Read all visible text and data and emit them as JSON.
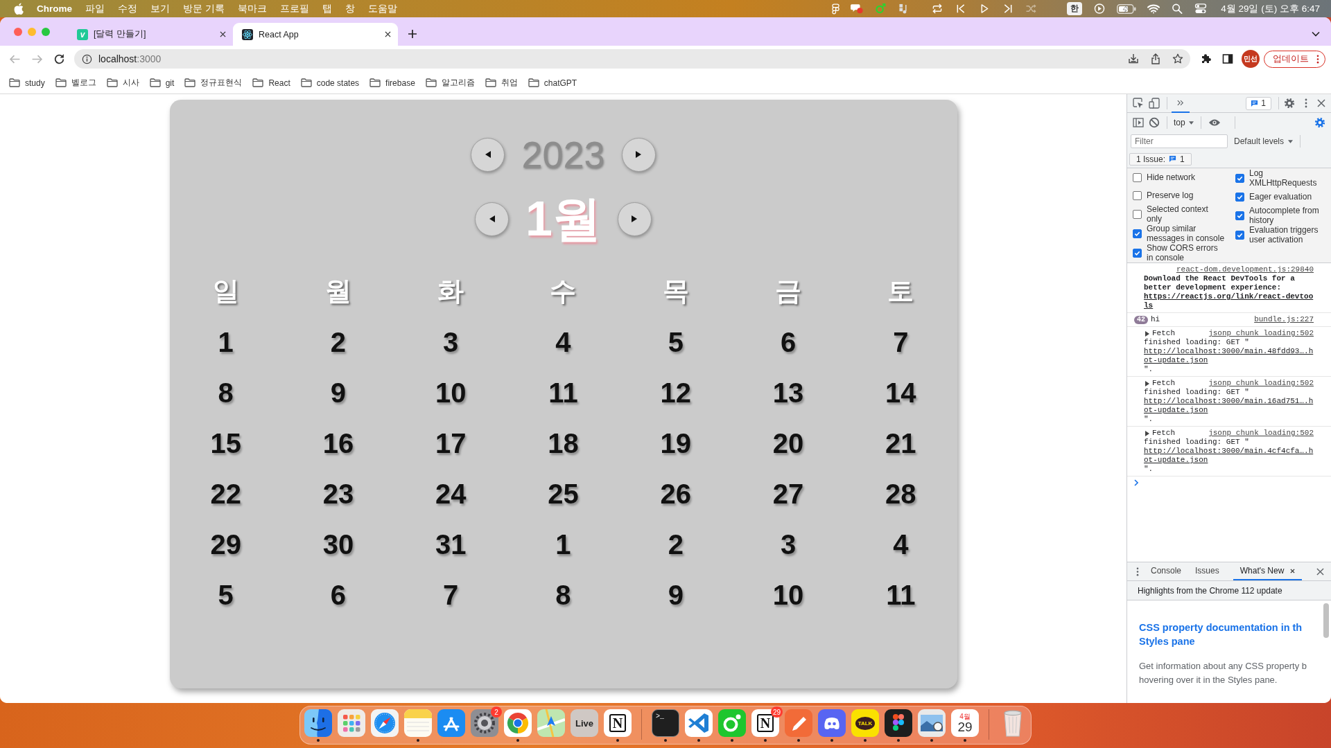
{
  "menu_bar": {
    "app": "Chrome",
    "menus": [
      "파일",
      "수정",
      "보기",
      "방문 기록",
      "북마크",
      "프로필",
      "탭",
      "창",
      "도움말"
    ],
    "input_source": "한",
    "clock": "4월 29일 (토) 오후 6:47"
  },
  "tabs": [
    {
      "kind": "letter",
      "favicon_text": "v",
      "title": "[달력 만들기]",
      "selected": false
    },
    {
      "kind": "react",
      "title": "React App",
      "selected": true
    }
  ],
  "toolbar": {
    "back_disabled": true,
    "forward_disabled": true,
    "url_host": "localhost",
    "url_port": ":3000",
    "profile": "민선",
    "update_button": "업데이트"
  },
  "bookmarks": [
    "study",
    "벨로그",
    "시사",
    "git",
    "정규표현식",
    "React",
    "code states",
    "firebase",
    "알고리즘",
    "취업",
    "chatGPT"
  ],
  "calendar": {
    "year": "2023",
    "month": "1월",
    "weekdays": [
      "일",
      "월",
      "화",
      "수",
      "목",
      "금",
      "토"
    ],
    "weeks": [
      [
        "1",
        "2",
        "3",
        "4",
        "5",
        "6",
        "7"
      ],
      [
        "8",
        "9",
        "10",
        "11",
        "12",
        "13",
        "14"
      ],
      [
        "15",
        "16",
        "17",
        "18",
        "19",
        "20",
        "21"
      ],
      [
        "22",
        "23",
        "24",
        "25",
        "26",
        "27",
        "28"
      ],
      [
        "29",
        "30",
        "31",
        "1",
        "2",
        "3",
        "4"
      ],
      [
        "5",
        "6",
        "7",
        "8",
        "9",
        "10",
        "11"
      ]
    ]
  },
  "devtools": {
    "more_tabs_selected": true,
    "issues_badge": "1",
    "context": "top",
    "settings_open": true,
    "filter_placeholder": "Filter",
    "levels": "Default levels",
    "issues_label": "1 Issue:",
    "issues_count": "1",
    "settings_left": [
      {
        "label": "Hide network",
        "checked": false
      },
      {
        "label": "Preserve log",
        "checked": false
      },
      {
        "label": "Selected context only",
        "checked": false
      },
      {
        "label": "Group similar messages in console",
        "checked": true
      },
      {
        "label": "Show CORS errors in console",
        "checked": true
      }
    ],
    "settings_right": [
      {
        "label": "Log XMLHttpRequests",
        "checked": true
      },
      {
        "label": "Eager evaluation",
        "checked": true
      },
      {
        "label": "Autocomplete from history",
        "checked": true
      },
      {
        "label": "Evaluation triggers user activation",
        "checked": true
      }
    ],
    "messages": [
      {
        "kind": "info",
        "source": "react-dom.development.js:29840",
        "text": "Download the React DevTools for a better development experience:",
        "link": "https://reactjs.org/link/react-devtools"
      },
      {
        "kind": "repeat",
        "count": "42",
        "text": "hi",
        "source": "bundle.js:227"
      },
      {
        "kind": "fetch",
        "label": "Fetch",
        "expanded": false,
        "source": "jsonp chunk loading:502",
        "text": "finished loading: GET \"",
        "link": "http://localhost:3000/main.48fdd93….hot-update.json",
        "after": "\"."
      },
      {
        "kind": "fetch",
        "label": "Fetch",
        "expanded": false,
        "source": "jsonp chunk loading:502",
        "text": "finished loading: GET \"",
        "link": "http://localhost:3000/main.16ad751….hot-update.json",
        "after": "\"."
      },
      {
        "kind": "fetch",
        "label": "Fetch",
        "expanded": false,
        "source": "jsonp chunk loading:502",
        "text": "finished loading: GET \"",
        "link": "http://localhost:3000/main.4cf4cfa….hot-update.json",
        "after": "\"."
      }
    ],
    "drawer": {
      "tabs": [
        {
          "label": "Console",
          "selected": false,
          "closable": false
        },
        {
          "label": "Issues",
          "selected": false,
          "closable": false
        },
        {
          "label": "What's New",
          "selected": true,
          "closable": true
        }
      ],
      "banner": "Highlights from the Chrome 112 update",
      "heading_lines": [
        "CSS property documentation in th",
        "Styles pane"
      ],
      "body_lines": [
        "Get information about any CSS property b",
        "hovering over it in the Styles pane."
      ]
    }
  },
  "dock": {
    "sections": [
      {
        "items": [
          {
            "kind": "finder",
            "running": true
          },
          {
            "kind": "launchpad",
            "running": false
          },
          {
            "kind": "safari",
            "running": false
          },
          {
            "kind": "notes",
            "running": true
          },
          {
            "kind": "appstore",
            "running": false
          },
          {
            "kind": "settings",
            "badge": "2",
            "running": false
          },
          {
            "kind": "chrome",
            "running": true
          },
          {
            "kind": "maps",
            "running": false
          },
          {
            "kind": "live",
            "label": "Live",
            "running": false
          },
          {
            "kind": "notion",
            "label": "N",
            "running": true
          }
        ]
      },
      {
        "items": [
          {
            "kind": "terminal",
            "label": ">_",
            "running": true
          },
          {
            "kind": "vscode",
            "running": true
          },
          {
            "kind": "ring",
            "running": true
          },
          {
            "kind": "notion",
            "label": "N",
            "badge": "29",
            "running": true
          },
          {
            "kind": "pen",
            "running": true
          },
          {
            "kind": "discord",
            "running": true
          },
          {
            "kind": "kakaotalk",
            "label": "TALK",
            "running": true
          },
          {
            "kind": "figma",
            "running": true
          },
          {
            "kind": "preview",
            "running": true
          },
          {
            "kind": "calendar",
            "month": "4월",
            "day": "29",
            "running": true
          }
        ]
      },
      {
        "items": [
          {
            "kind": "trash",
            "running": false
          }
        ]
      }
    ]
  }
}
